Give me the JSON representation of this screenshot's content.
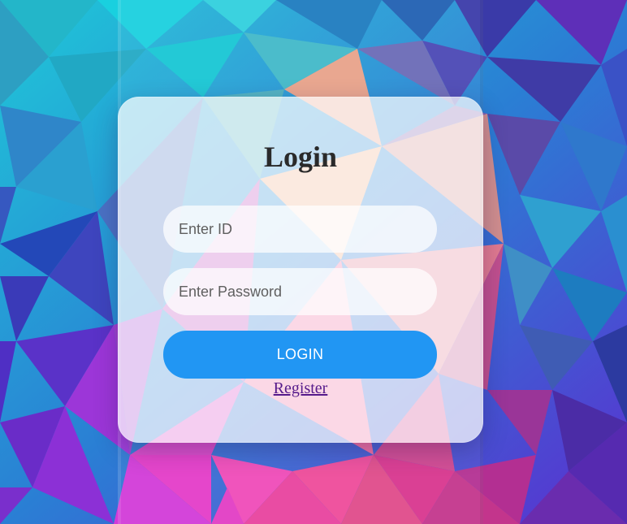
{
  "login_form": {
    "title": "Login",
    "id_placeholder": "Enter ID",
    "password_placeholder": "Enter Password",
    "login_button_label": "LOGIN",
    "register_link_label": "Register"
  },
  "colors": {
    "button_blue": "#2196f3",
    "link_visited_purple": "#551a8b",
    "title_text": "#2a2a2a"
  }
}
